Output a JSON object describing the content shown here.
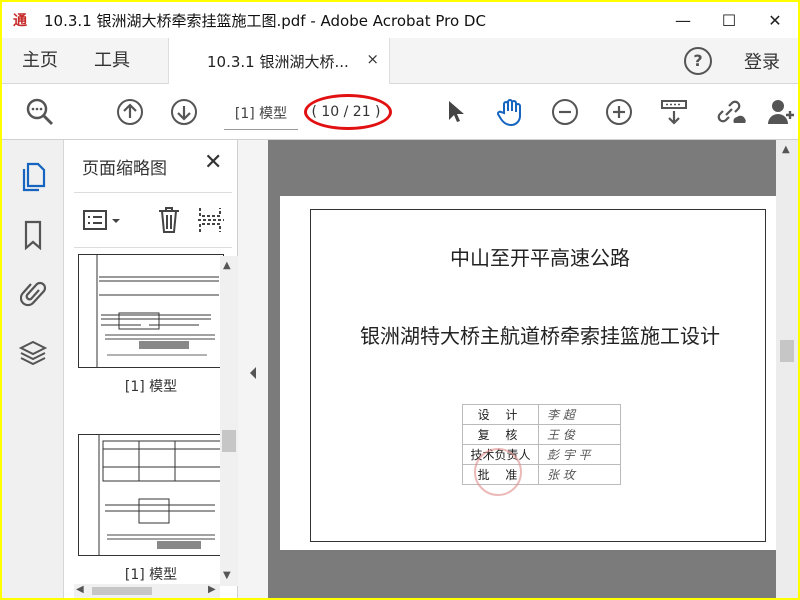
{
  "window": {
    "title": "10.3.1 银洲湖大桥牵索挂篮施工图.pdf - Adobe Acrobat Pro DC",
    "logo_text": "通",
    "minimize": "—",
    "maximize": "☐",
    "close": "✕"
  },
  "tabs": {
    "home": "主页",
    "tools": "工具",
    "doc_tab": "10.3.1 银洲湖大桥...",
    "doc_tab_close": "×",
    "help": "?",
    "login": "登录"
  },
  "toolbar": {
    "view_label": "[1] 模型",
    "page_indicator": "( 10 / 21 )",
    "highlight_color": "#e11111"
  },
  "thumbnails_panel": {
    "title": "页面缩略图",
    "close": "✕",
    "thumbnails": [
      {
        "label": "[1] 模型"
      },
      {
        "label": "[1] 模型"
      }
    ]
  },
  "document": {
    "heading": "中山至开平高速公路",
    "subheading": "银洲湖特大桥主航道桥牵索挂篮施工设计",
    "signature_table": [
      {
        "role": "设  计",
        "name": "李 超"
      },
      {
        "role": "复  核",
        "name": "王 俊"
      },
      {
        "role": "技术负责人",
        "name": "彭 宇 平"
      },
      {
        "role": "批  准",
        "name": "张 玫"
      }
    ]
  }
}
